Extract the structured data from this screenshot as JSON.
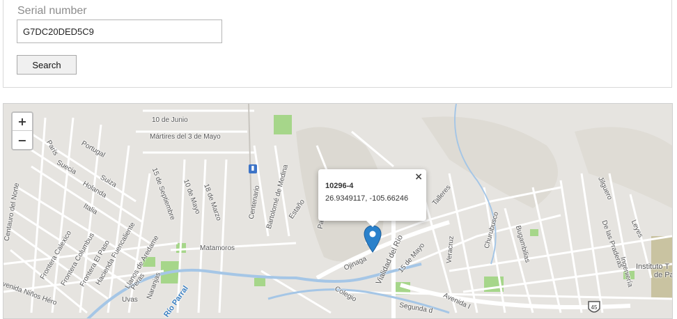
{
  "form": {
    "serial_label": "Serial number",
    "serial_value": "G7DC20DED5C9",
    "search_label": "Search"
  },
  "map": {
    "zoom_in": "+",
    "zoom_out": "−",
    "popup": {
      "title": "10296-4",
      "coords": "26.9349117, -105.66246",
      "close": "×"
    },
    "streets": {
      "diez_junio": "10 de Junio",
      "martires": "Mártires del 3 de Mayo",
      "portugal": "Portugal",
      "paris": "París",
      "suecia": "Suecia",
      "suiza": "Suiza",
      "holanda": "Holanda",
      "italia": "Italia",
      "centauro": "Centauro del Norte",
      "quince_sep": "15 de Septiembre",
      "diez_mayo": "10 de Mayo",
      "dieciocho_marzo": "18 de Marzo",
      "centenario": "Centenario",
      "bartolome": "Bartolomé de Medina",
      "estano": "Estaño",
      "pa": "Pa",
      "matamoros": "Matamoros",
      "frontera_calexico": "Frontera Calexico",
      "frontera_columbus": "Frontera Columbus",
      "frontera_elpaso": "Frontera El Paso",
      "hacienda": "Hacienda Fuencaliente",
      "llanos": "Llanos de Aredame",
      "avenida_ninos": "Avenida Niños Héro",
      "peras": "Peras",
      "naranjas": "Naranjas",
      "uvas": "Uvas",
      "rio_parral": "Río Parral",
      "ojinaga": "Ojinaga",
      "vialidad": "Vialidad del Río",
      "quince_mayo": "15 de Mayo",
      "colegio": "Colegio",
      "segunda": "Segunda d",
      "avenida": "Avenida I",
      "talleres": "Talleres",
      "veracruz": "Veracruz",
      "churubusco": "Churubusco",
      "bugambilias": "Bugambilias",
      "jilguero": "Jilguero",
      "leyes": "Leyes",
      "praderas": "De las Praderas",
      "ingenieria": "Ingeniería",
      "instituto": "Instituto T",
      "instituto2": "de Pa",
      "highway": "45"
    }
  }
}
